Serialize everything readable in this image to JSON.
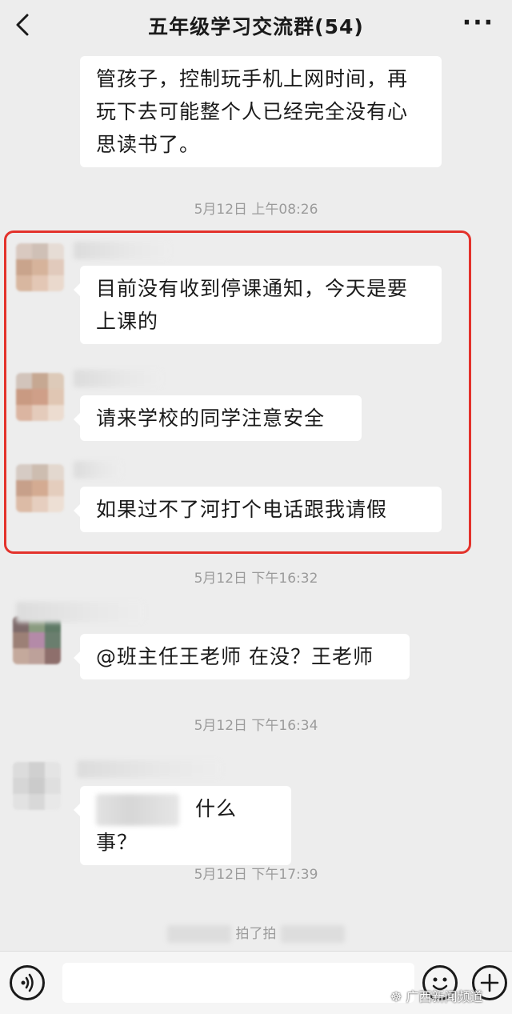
{
  "header": {
    "title": "五年级学习交流群(54)",
    "more": "···"
  },
  "messages": {
    "m0": "管孩子，控制玩手机上网时间，再玩下去可能整个人已经完全没有心思读书了。",
    "t1": "5月12日 上午08:26",
    "m1": "目前没有收到停课通知，今天是要上课的",
    "m2": "请来学校的同学注意安全",
    "m3": "如果过不了河打个电话跟我请假",
    "t2": "5月12日 下午16:32",
    "m4": "@班主任王老师  在没？王老师",
    "t3": "5月12日 下午16:34",
    "m5": "什么事？",
    "t4": "5月12日 下午17:39",
    "pat": "拍了拍"
  },
  "watermark": "广西新闻频道",
  "colors": {
    "highlight_border": "#e3322b",
    "background": "#ededed",
    "bubble": "#ffffff"
  }
}
